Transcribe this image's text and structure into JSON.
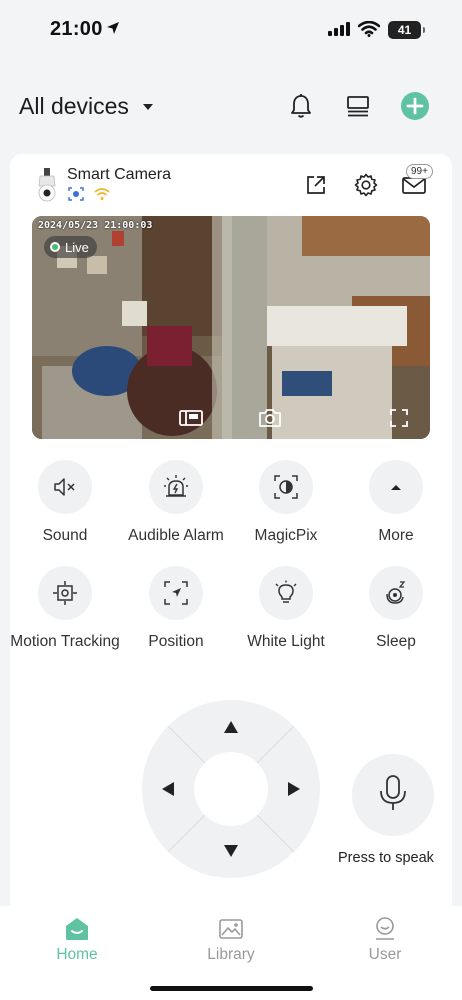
{
  "status_bar": {
    "time": "21:00",
    "battery": "41"
  },
  "header": {
    "title": "All devices"
  },
  "device": {
    "name": "Smart Camera",
    "message_count": "99+"
  },
  "video": {
    "timestamp": "2024/05/23 21:00:03",
    "live_label": "Live"
  },
  "features": [
    {
      "label": "Sound",
      "icon": "speaker-mute-icon"
    },
    {
      "label": "Audible Alarm",
      "icon": "alarm-siren-icon"
    },
    {
      "label": "MagicPix",
      "icon": "magicpix-icon"
    },
    {
      "label": "More",
      "icon": "caret-up-icon"
    },
    {
      "label": "Motion Tracking",
      "icon": "motion-tracking-icon"
    },
    {
      "label": "Position",
      "icon": "position-icon"
    },
    {
      "label": "White Light",
      "icon": "light-bulb-icon"
    },
    {
      "label": "Sleep",
      "icon": "sleep-icon"
    }
  ],
  "speak": {
    "label": "Press to speak"
  },
  "nav": [
    {
      "label": "Home",
      "active": true
    },
    {
      "label": "Library",
      "active": false
    },
    {
      "label": "User",
      "active": false
    }
  ],
  "colors": {
    "accent": "#5fc2a3",
    "background": "#f3f4f6",
    "live_dot": "#3dbf6b"
  }
}
